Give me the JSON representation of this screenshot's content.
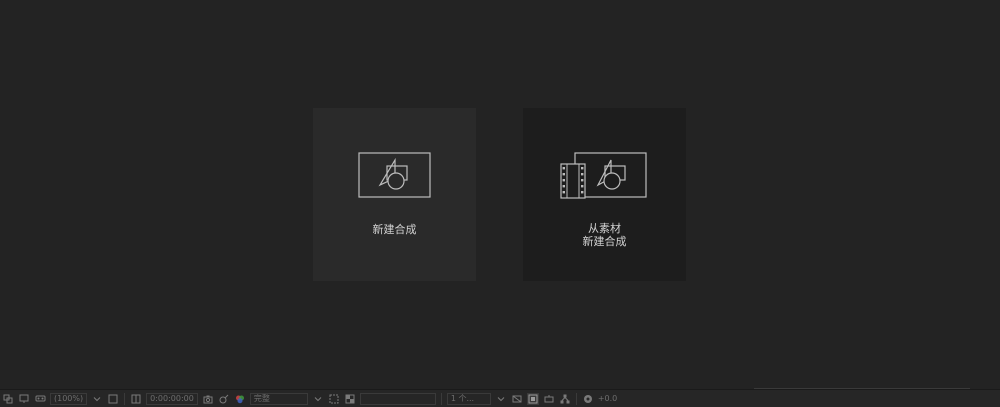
{
  "cards": {
    "new_comp": {
      "label": "新建合成"
    },
    "from_footage": {
      "line1": "从素材",
      "line2": "新建合成"
    }
  },
  "statusbar": {
    "zoom": "(100%)",
    "timecode": "0:00:00:00",
    "resolution": "完整",
    "view_field": "",
    "views": "1 个...",
    "exposure": "+0.0"
  },
  "colors": {
    "background": "#232323",
    "card_active": "#2a2a2a",
    "card_dark": "#1d1d1d",
    "icon_stroke": "#bdbdbd",
    "text": "#d2d2d2"
  }
}
